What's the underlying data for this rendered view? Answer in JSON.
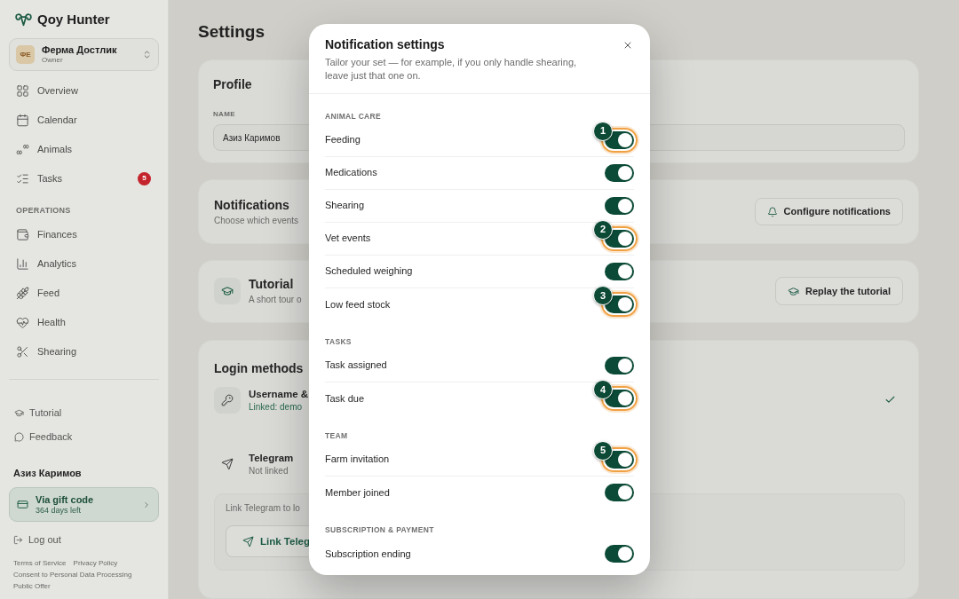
{
  "sidebar": {
    "brand": "Qoy Hunter",
    "farm": {
      "initials": "ФЕ",
      "name": "Ферма Достлик",
      "role": "Owner"
    },
    "nav_groups": [
      {
        "items": [
          {
            "label": "Overview",
            "selected": false
          },
          {
            "label": "Calendar",
            "selected": false
          },
          {
            "label": "Animals",
            "selected": false
          },
          {
            "label": "Tasks",
            "selected": false,
            "count": "5"
          }
        ]
      },
      {
        "title": "OPERATIONS",
        "items": [
          {
            "label": "Finances",
            "selected": false
          },
          {
            "label": "Analytics",
            "selected": false
          },
          {
            "label": "Feed",
            "selected": false
          },
          {
            "label": "Health",
            "selected": false
          },
          {
            "label": "Shearing",
            "selected": false
          }
        ]
      }
    ],
    "help_links": [
      "Tutorial",
      "Feedback"
    ],
    "user_name": "Азиз Каримов",
    "plan": {
      "title": "Via gift code",
      "subtitle": "364 days left"
    },
    "logout": "Log out",
    "legal_links": [
      "Terms of Service",
      "Privacy Policy",
      "Consent to Personal Data Processing",
      "Public Offer"
    ]
  },
  "page": {
    "title": "Settings",
    "profile": {
      "title": "Profile",
      "field_label": "NAME",
      "value": "Азиз Каримов"
    },
    "notifications": {
      "title": "Notifications",
      "description": "Choose which events",
      "button": "Configure notifications"
    },
    "tutorial": {
      "title": "Tutorial",
      "description": "A short tour o",
      "button": "Replay the tutorial"
    },
    "login_methods": {
      "title": "Login methods",
      "methods": [
        {
          "name": "Username &",
          "status": "Linked: demo",
          "linked": true
        },
        {
          "name": "Telegram",
          "status": "Not linked",
          "linked": false
        }
      ],
      "hint": "Link Telegram to lo",
      "button": "Link Teleg"
    }
  },
  "dialog": {
    "title": "Notification settings",
    "description": "Tailor your set — for example, if you only handle shearing, leave just that one on.",
    "groups": [
      {
        "title": "ANIMAL CARE",
        "items": [
          {
            "label": "Feeding",
            "on": true,
            "callout": "1"
          },
          {
            "label": "Medications",
            "on": true
          },
          {
            "label": "Shearing",
            "on": true
          },
          {
            "label": "Vet events",
            "on": true,
            "callout": "2"
          },
          {
            "label": "Scheduled weighing",
            "on": true
          },
          {
            "label": "Low feed stock",
            "on": true,
            "callout": "3"
          }
        ]
      },
      {
        "title": "TASKS",
        "items": [
          {
            "label": "Task assigned",
            "on": true
          },
          {
            "label": "Task due",
            "on": true,
            "callout": "4"
          }
        ]
      },
      {
        "title": "TEAM",
        "items": [
          {
            "label": "Farm invitation",
            "on": true,
            "callout": "5"
          },
          {
            "label": "Member joined",
            "on": true
          }
        ]
      },
      {
        "title": "SUBSCRIPTION & PAYMENT",
        "items": [
          {
            "label": "Subscription ending",
            "on": true
          }
        ]
      }
    ]
  }
}
